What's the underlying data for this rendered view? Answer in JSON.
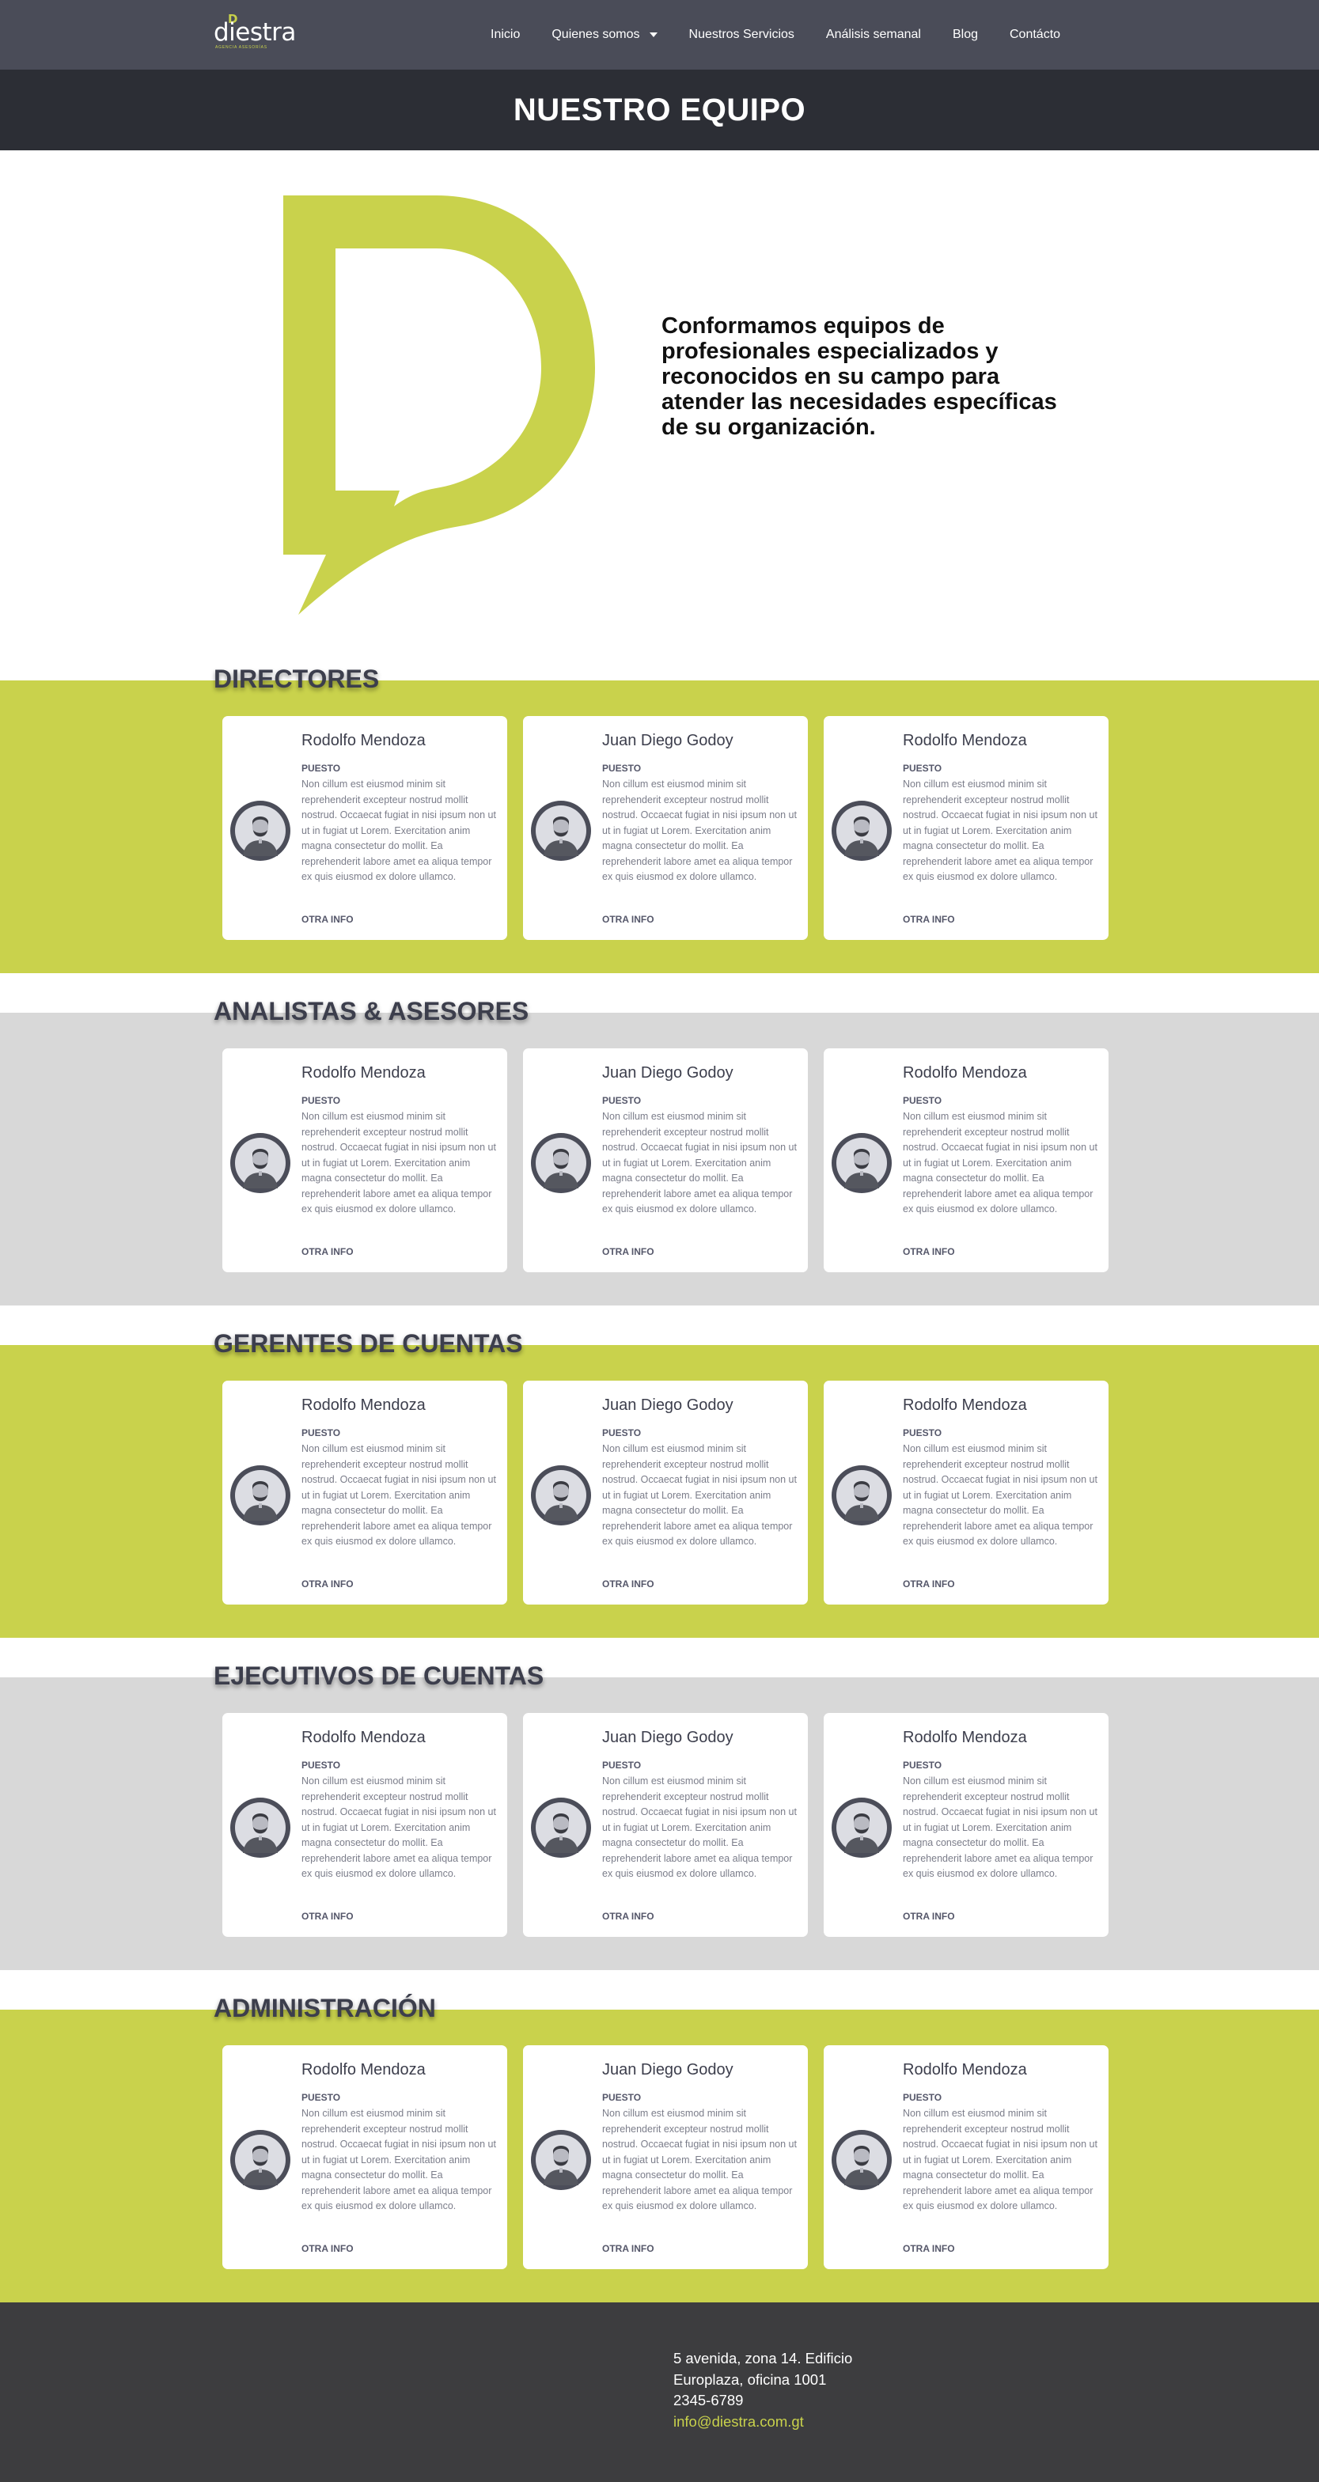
{
  "brand": {
    "logo_text": "diestra",
    "logo_tagline": "AGENCIA ASESORÍAS",
    "accent_color": "#c9d24c",
    "nav_color": "#4a4c58"
  },
  "nav": {
    "items": [
      {
        "label": "Inicio"
      },
      {
        "label": "Quienes somos",
        "has_dropdown": true
      },
      {
        "label": "Nuestros Servicios"
      },
      {
        "label": "Análisis semanal"
      },
      {
        "label": "Blog"
      },
      {
        "label": "Contácto"
      }
    ]
  },
  "page_title": "NUESTRO EQUIPO",
  "hero": {
    "text": "Conformamos equipos de profesionales especializados y reconocidos en su campo para atender las necesidades específicas de su organización."
  },
  "sections": [
    {
      "title": "DIRECTORES",
      "band": "lime",
      "cards": [
        {
          "name": "Rodolfo Mendoza",
          "role": "PUESTO",
          "description": "Non cillum est eiusmod minim sit reprehenderit excepteur nostrud mollit nostrud. Occaecat fugiat in nisi ipsum non ut ut in fugiat ut Lorem. Exercitation anim magna consectetur do mollit. Ea reprehenderit labore amet ea aliqua tempor ex quis eiusmod ex dolore ullamco.",
          "link": "OTRA INFO"
        },
        {
          "name": "Juan Diego Godoy",
          "role": "PUESTO",
          "description": "Non cillum est eiusmod minim sit reprehenderit excepteur nostrud mollit nostrud. Occaecat fugiat in nisi ipsum non ut ut in fugiat ut Lorem. Exercitation anim magna consectetur do mollit. Ea reprehenderit labore amet ea aliqua tempor ex quis eiusmod ex dolore ullamco.",
          "link": "OTRA INFO"
        },
        {
          "name": "Rodolfo Mendoza",
          "role": "PUESTO",
          "description": "Non cillum est eiusmod minim sit reprehenderit excepteur nostrud mollit nostrud. Occaecat fugiat in nisi ipsum non ut ut in fugiat ut Lorem. Exercitation anim magna consectetur do mollit. Ea reprehenderit labore amet ea aliqua tempor ex quis eiusmod ex dolore ullamco.",
          "link": "OTRA INFO"
        }
      ]
    },
    {
      "title": "ANALISTAS & ASESORES",
      "band": "gray",
      "cards": [
        {
          "name": "Rodolfo Mendoza",
          "role": "PUESTO",
          "description": "Non cillum est eiusmod minim sit reprehenderit excepteur nostrud mollit nostrud. Occaecat fugiat in nisi ipsum non ut ut in fugiat ut Lorem. Exercitation anim magna consectetur do mollit. Ea reprehenderit labore amet ea aliqua tempor ex quis eiusmod ex dolore ullamco.",
          "link": "OTRA INFO"
        },
        {
          "name": "Juan Diego Godoy",
          "role": "PUESTO",
          "description": "Non cillum est eiusmod minim sit reprehenderit excepteur nostrud mollit nostrud. Occaecat fugiat in nisi ipsum non ut ut in fugiat ut Lorem. Exercitation anim magna consectetur do mollit. Ea reprehenderit labore amet ea aliqua tempor ex quis eiusmod ex dolore ullamco.",
          "link": "OTRA INFO"
        },
        {
          "name": "Rodolfo Mendoza",
          "role": "PUESTO",
          "description": "Non cillum est eiusmod minim sit reprehenderit excepteur nostrud mollit nostrud. Occaecat fugiat in nisi ipsum non ut ut in fugiat ut Lorem. Exercitation anim magna consectetur do mollit. Ea reprehenderit labore amet ea aliqua tempor ex quis eiusmod ex dolore ullamco.",
          "link": "OTRA INFO"
        }
      ]
    },
    {
      "title": "GERENTES DE CUENTAS",
      "band": "lime",
      "cards": [
        {
          "name": "Rodolfo Mendoza",
          "role": "PUESTO",
          "description": "Non cillum est eiusmod minim sit reprehenderit excepteur nostrud mollit nostrud. Occaecat fugiat in nisi ipsum non ut ut in fugiat ut Lorem. Exercitation anim magna consectetur do mollit. Ea reprehenderit labore amet ea aliqua tempor ex quis eiusmod ex dolore ullamco.",
          "link": "OTRA INFO"
        },
        {
          "name": "Juan Diego Godoy",
          "role": "PUESTO",
          "description": "Non cillum est eiusmod minim sit reprehenderit excepteur nostrud mollit nostrud. Occaecat fugiat in nisi ipsum non ut ut in fugiat ut Lorem. Exercitation anim magna consectetur do mollit. Ea reprehenderit labore amet ea aliqua tempor ex quis eiusmod ex dolore ullamco.",
          "link": "OTRA INFO"
        },
        {
          "name": "Rodolfo Mendoza",
          "role": "PUESTO",
          "description": "Non cillum est eiusmod minim sit reprehenderit excepteur nostrud mollit nostrud. Occaecat fugiat in nisi ipsum non ut ut in fugiat ut Lorem. Exercitation anim magna consectetur do mollit. Ea reprehenderit labore amet ea aliqua tempor ex quis eiusmod ex dolore ullamco.",
          "link": "OTRA INFO"
        }
      ]
    },
    {
      "title": "EJECUTIVOS DE CUENTAS",
      "band": "gray",
      "cards": [
        {
          "name": "Rodolfo Mendoza",
          "role": "PUESTO",
          "description": "Non cillum est eiusmod minim sit reprehenderit excepteur nostrud mollit nostrud. Occaecat fugiat in nisi ipsum non ut ut in fugiat ut Lorem. Exercitation anim magna consectetur do mollit. Ea reprehenderit labore amet ea aliqua tempor ex quis eiusmod ex dolore ullamco.",
          "link": "OTRA INFO"
        },
        {
          "name": "Juan Diego Godoy",
          "role": "PUESTO",
          "description": "Non cillum est eiusmod minim sit reprehenderit excepteur nostrud mollit nostrud. Occaecat fugiat in nisi ipsum non ut ut in fugiat ut Lorem. Exercitation anim magna consectetur do mollit. Ea reprehenderit labore amet ea aliqua tempor ex quis eiusmod ex dolore ullamco.",
          "link": "OTRA INFO"
        },
        {
          "name": "Rodolfo Mendoza",
          "role": "PUESTO",
          "description": "Non cillum est eiusmod minim sit reprehenderit excepteur nostrud mollit nostrud. Occaecat fugiat in nisi ipsum non ut ut in fugiat ut Lorem. Exercitation anim magna consectetur do mollit. Ea reprehenderit labore amet ea aliqua tempor ex quis eiusmod ex dolore ullamco.",
          "link": "OTRA INFO"
        }
      ]
    },
    {
      "title": "ADMINISTRACIÓN",
      "band": "lime",
      "cards": [
        {
          "name": "Rodolfo Mendoza",
          "role": "PUESTO",
          "description": "Non cillum est eiusmod minim sit reprehenderit excepteur nostrud mollit nostrud. Occaecat fugiat in nisi ipsum non ut ut in fugiat ut Lorem. Exercitation anim magna consectetur do mollit. Ea reprehenderit labore amet ea aliqua tempor ex quis eiusmod ex dolore ullamco.",
          "link": "OTRA INFO"
        },
        {
          "name": "Juan Diego Godoy",
          "role": "PUESTO",
          "description": "Non cillum est eiusmod minim sit reprehenderit excepteur nostrud mollit nostrud. Occaecat fugiat in nisi ipsum non ut ut in fugiat ut Lorem. Exercitation anim magna consectetur do mollit. Ea reprehenderit labore amet ea aliqua tempor ex quis eiusmod ex dolore ullamco.",
          "link": "OTRA INFO"
        },
        {
          "name": "Rodolfo Mendoza",
          "role": "PUESTO",
          "description": "Non cillum est eiusmod minim sit reprehenderit excepteur nostrud mollit nostrud. Occaecat fugiat in nisi ipsum non ut ut in fugiat ut Lorem. Exercitation anim magna consectetur do mollit. Ea reprehenderit labore amet ea aliqua tempor ex quis eiusmod ex dolore ullamco.",
          "link": "OTRA INFO"
        }
      ]
    }
  ],
  "footer": {
    "address_line1": "5 avenida, zona 14. Edificio",
    "address_line2": "Europlaza, oficina 1001",
    "phone": "2345-6789",
    "email": "info@diestra.com.gt"
  }
}
